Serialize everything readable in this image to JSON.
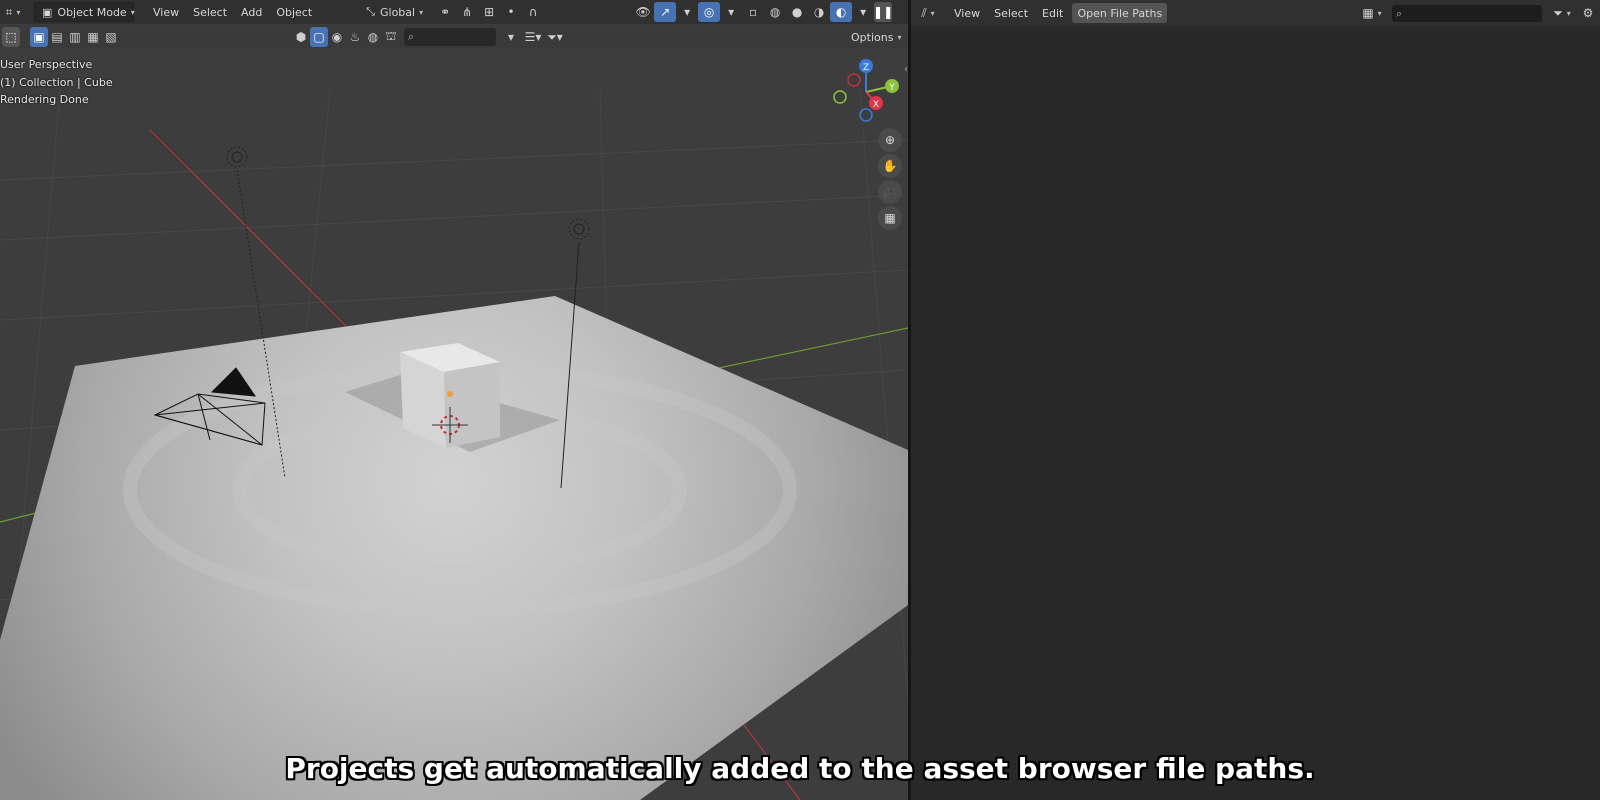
{
  "viewport_header": {
    "mode_label": "Object Mode",
    "menus": [
      "View",
      "Select",
      "Add",
      "Object"
    ],
    "transform_orientation": "Global"
  },
  "tool_header": {
    "options_label": "Options"
  },
  "viewport_overlay": {
    "perspective": "User Perspective",
    "collection": "(1) Collection | Cube",
    "status": "Rendering Done"
  },
  "gizmo": {
    "z": "Z",
    "y": "Y",
    "x": "X"
  },
  "file_browser": {
    "menus": [
      "View",
      "Select",
      "Edit"
    ],
    "active_button": "Open File Paths",
    "search_value": ""
  },
  "caption": "Projects get automatically added to the asset browser file paths.",
  "colors": {
    "accent": "#4772b3",
    "x_axis": "#e0344a",
    "y_axis": "#8bc23a",
    "z_axis": "#3a7ad8"
  },
  "icons": [
    "editor-type-icon",
    "object-mode-icon",
    "orientation-icon",
    "pivot-icon",
    "snap-icon",
    "proportional-icon",
    "visibility-icon",
    "gizmo-icon",
    "overlay-icon",
    "xray-icon",
    "wireframe-icon",
    "solid-icon",
    "material-icon",
    "rendered-icon",
    "zoom-icon",
    "pan-icon",
    "camera-view-icon",
    "grid-view-icon",
    "search-icon",
    "filter-icon",
    "gear-icon"
  ]
}
